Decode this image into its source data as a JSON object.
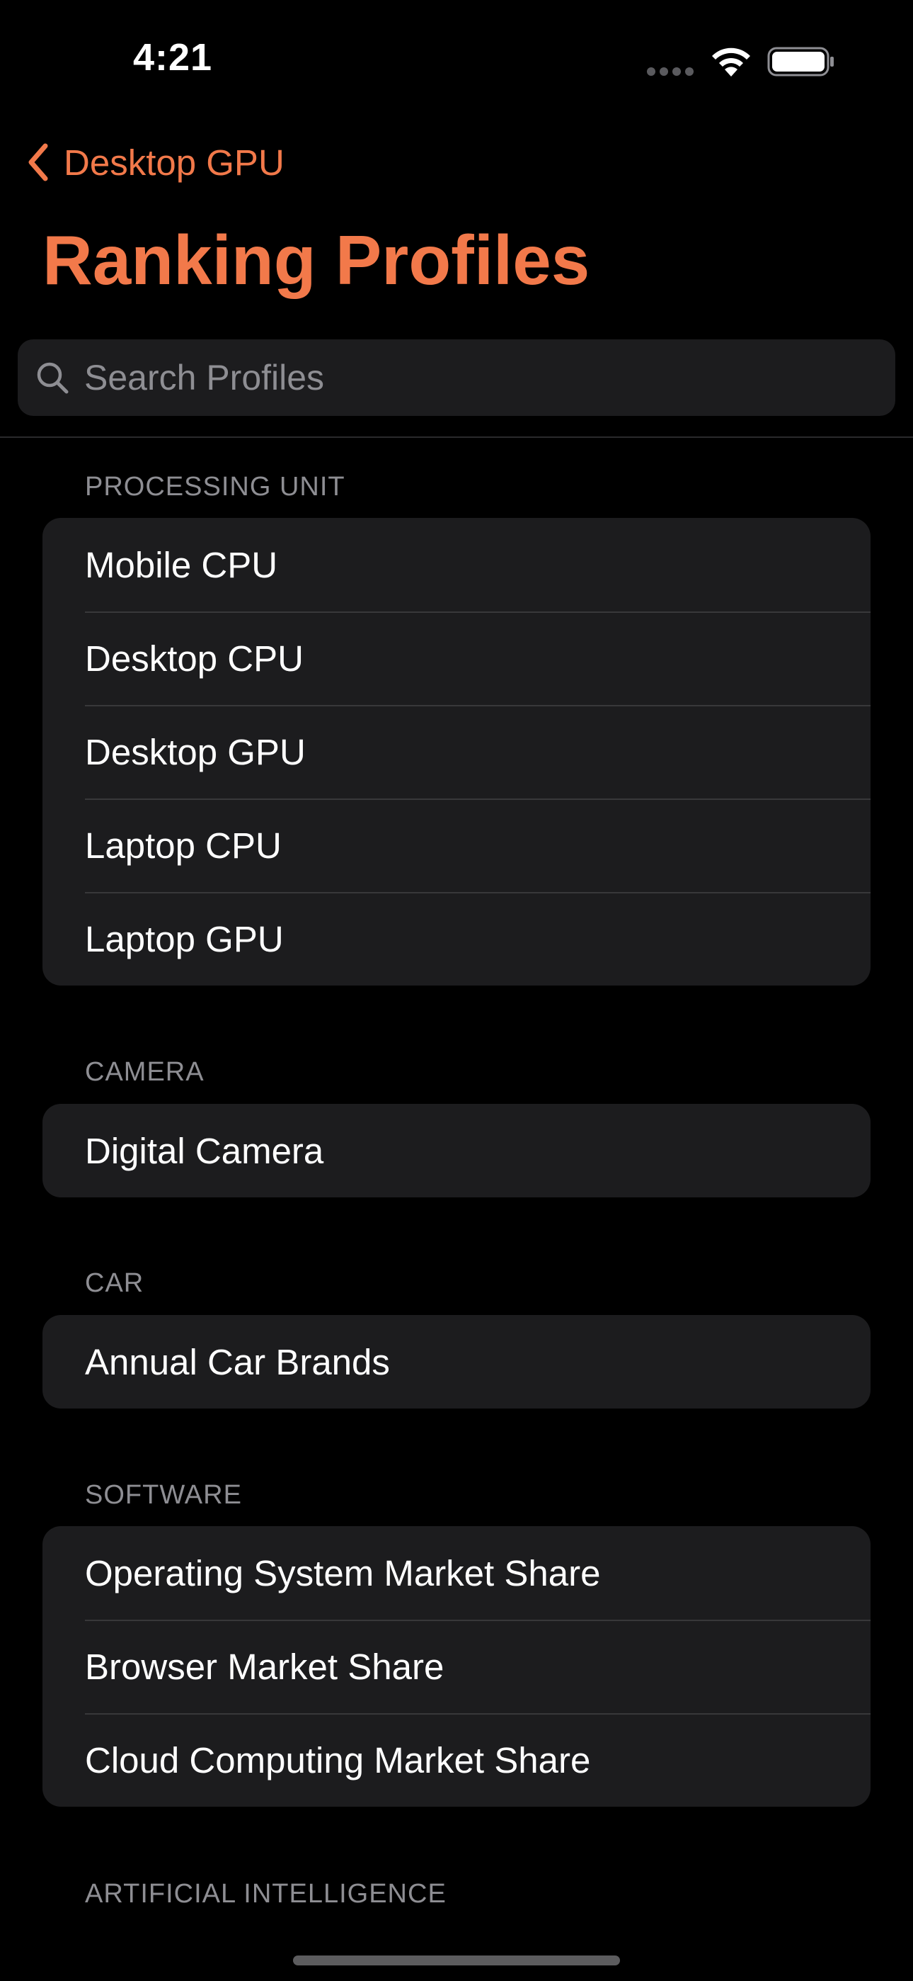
{
  "status_bar": {
    "time": "4:21"
  },
  "nav": {
    "back_label": "Desktop GPU",
    "title": "Ranking Profiles"
  },
  "search": {
    "placeholder": "Search Profiles",
    "value": ""
  },
  "sections": [
    {
      "header": "PROCESSING UNIT",
      "items": [
        "Mobile CPU",
        "Desktop CPU",
        "Desktop GPU",
        "Laptop CPU",
        "Laptop GPU"
      ]
    },
    {
      "header": "CAMERA",
      "items": [
        "Digital Camera"
      ]
    },
    {
      "header": "CAR",
      "items": [
        "Annual Car Brands"
      ]
    },
    {
      "header": "SOFTWARE",
      "items": [
        "Operating System Market Share",
        "Browser Market Share",
        "Cloud Computing Market Share"
      ]
    },
    {
      "header": "ARTIFICIAL INTELLIGENCE",
      "items": []
    }
  ],
  "colors": {
    "accent": "#f2794a",
    "background": "#000000",
    "cell": "#1c1c1e",
    "secondary_text": "#8e8e93"
  },
  "icons": {
    "back": "chevron-left-icon",
    "search": "search-icon",
    "wifi": "wifi-icon",
    "battery": "battery-icon",
    "signal": "cellular-signal-icon"
  }
}
